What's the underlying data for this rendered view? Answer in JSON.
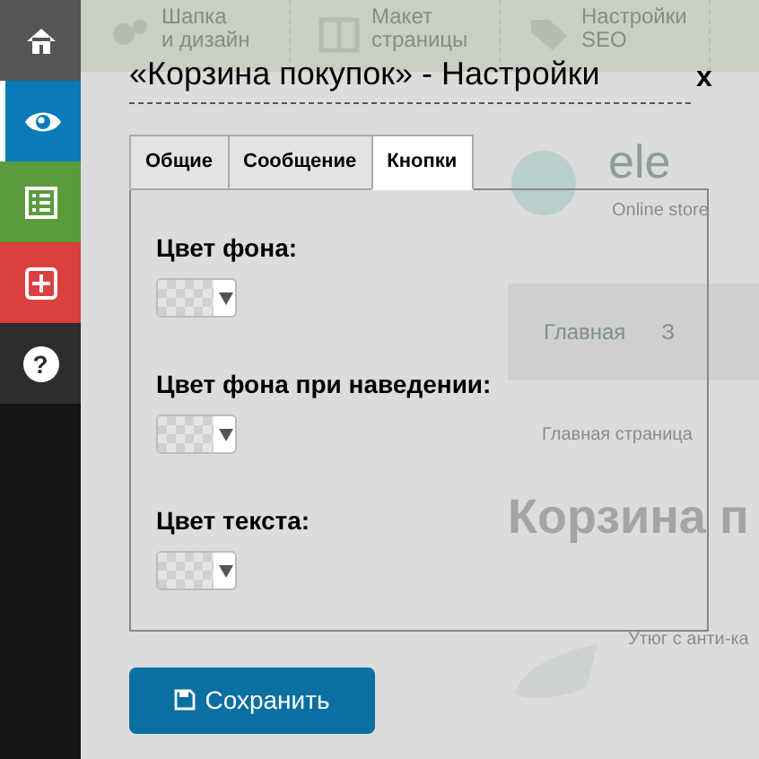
{
  "sidebar": {
    "items": [
      {
        "selected": false
      },
      {
        "selected": true
      },
      {
        "selected": false
      },
      {
        "selected": false
      },
      {
        "selected": false,
        "label": "?"
      }
    ]
  },
  "background_site": {
    "toolbar": [
      {
        "label": "Шапка\nи дизайн"
      },
      {
        "label": "Макет\nстраницы"
      },
      {
        "label": "Настройки\nSEO"
      }
    ],
    "logo_text": "ele",
    "logo_subtitle": "Online store",
    "nav": [
      {
        "label": "Главная"
      },
      {
        "label": "З"
      }
    ],
    "breadcrumb": "Главная страница",
    "heading": "Корзина п",
    "product": "Утюг с анти-ка"
  },
  "dialog": {
    "title": "«Корзина покупок» - Настройки",
    "close": "x",
    "tabs": [
      {
        "label": "Общие",
        "selected": false
      },
      {
        "label": "Сообщение",
        "selected": false
      },
      {
        "label": "Кнопки",
        "selected": true
      }
    ],
    "fields": [
      {
        "label": "Цвет фона:"
      },
      {
        "label": "Цвет фона при наведении:"
      },
      {
        "label": "Цвет текста:"
      }
    ],
    "save_button": "Сохранить"
  }
}
